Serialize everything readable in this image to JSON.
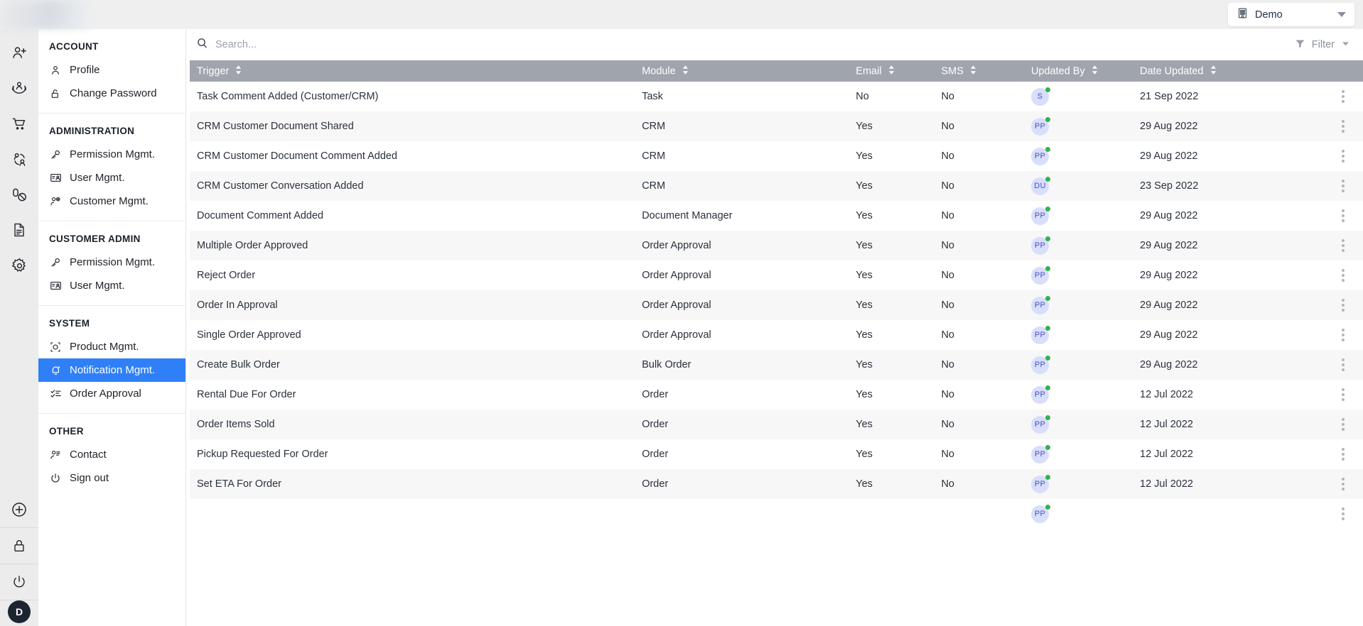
{
  "topbar": {
    "org_label": "Demo",
    "org_icon": "building-icon",
    "caret_icon": "chevron-down-icon"
  },
  "rail": {
    "icons": [
      {
        "name": "add-user-icon"
      },
      {
        "name": "customer-care-icon"
      },
      {
        "name": "shopping-cart-icon"
      },
      {
        "name": "user-group-icon"
      },
      {
        "name": "pills-icon"
      },
      {
        "name": "document-icon"
      },
      {
        "name": "gear-icon"
      }
    ],
    "bottom_icons": [
      {
        "name": "add-circle-icon"
      },
      {
        "name": "lock-icon"
      },
      {
        "name": "power-icon"
      }
    ],
    "avatar_initial": "D"
  },
  "sidebar": {
    "groups": [
      {
        "title": "ACCOUNT",
        "items": [
          {
            "label": "Profile",
            "icon": "user-icon",
            "active": false
          },
          {
            "label": "Change Password",
            "icon": "unlock-icon",
            "active": false
          }
        ]
      },
      {
        "title": "ADMINISTRATION",
        "items": [
          {
            "label": "Permission Mgmt.",
            "icon": "key-icon",
            "active": false
          },
          {
            "label": "User Mgmt.",
            "icon": "id-card-icon",
            "active": false
          },
          {
            "label": "Customer Mgmt.",
            "icon": "user-gear-icon",
            "active": false
          }
        ]
      },
      {
        "title": "CUSTOMER ADMIN",
        "items": [
          {
            "label": "Permission Mgmt.",
            "icon": "key-icon",
            "active": false
          },
          {
            "label": "User Mgmt.",
            "icon": "id-card-icon",
            "active": false
          }
        ]
      },
      {
        "title": "SYSTEM",
        "items": [
          {
            "label": "Product Mgmt.",
            "icon": "box-icon",
            "active": false
          },
          {
            "label": "Notification Mgmt.",
            "icon": "bell-icon",
            "active": true
          },
          {
            "label": "Order Approval",
            "icon": "checklist-icon",
            "active": false
          }
        ]
      },
      {
        "title": "OTHER",
        "items": [
          {
            "label": "Contact",
            "icon": "contact-icon",
            "active": false
          },
          {
            "label": "Sign out",
            "icon": "power-icon",
            "active": false
          }
        ]
      }
    ]
  },
  "toolbar": {
    "search_placeholder": "Search...",
    "search_value": "",
    "search_icon": "search-icon",
    "filter_label": "Filter",
    "filter_icon": "funnel-icon",
    "filter_caret_icon": "chevron-down-icon"
  },
  "table": {
    "columns": [
      {
        "key": "trigger",
        "label": "Trigger",
        "sortable": true
      },
      {
        "key": "module",
        "label": "Module",
        "sortable": true
      },
      {
        "key": "email",
        "label": "Email",
        "sortable": true
      },
      {
        "key": "sms",
        "label": "SMS",
        "sortable": true
      },
      {
        "key": "updated_by",
        "label": "Updated By",
        "sortable": true
      },
      {
        "key": "date_updated",
        "label": "Date Updated",
        "sortable": true
      }
    ],
    "row_action_icon": "kebab-menu-icon",
    "rows": [
      {
        "trigger": "Task Comment Added (Customer/CRM)",
        "module": "Task",
        "email": "No",
        "sms": "No",
        "updated_by": "S",
        "date_updated": "21 Sep 2022",
        "status": "online"
      },
      {
        "trigger": "CRM Customer Document Shared",
        "module": "CRM",
        "email": "Yes",
        "sms": "No",
        "updated_by": "PP",
        "date_updated": "29 Aug 2022",
        "status": "online"
      },
      {
        "trigger": "CRM Customer Document Comment Added",
        "module": "CRM",
        "email": "Yes",
        "sms": "No",
        "updated_by": "PP",
        "date_updated": "29 Aug 2022",
        "status": "online"
      },
      {
        "trigger": "CRM Customer Conversation Added",
        "module": "CRM",
        "email": "Yes",
        "sms": "No",
        "updated_by": "DU",
        "date_updated": "23 Sep 2022",
        "status": "online"
      },
      {
        "trigger": "Document Comment Added",
        "module": "Document Manager",
        "email": "Yes",
        "sms": "No",
        "updated_by": "PP",
        "date_updated": "29 Aug 2022",
        "status": "online"
      },
      {
        "trigger": "Multiple Order Approved",
        "module": "Order Approval",
        "email": "Yes",
        "sms": "No",
        "updated_by": "PP",
        "date_updated": "29 Aug 2022",
        "status": "online"
      },
      {
        "trigger": "Reject Order",
        "module": "Order Approval",
        "email": "Yes",
        "sms": "No",
        "updated_by": "PP",
        "date_updated": "29 Aug 2022",
        "status": "online"
      },
      {
        "trigger": "Order In Approval",
        "module": "Order Approval",
        "email": "Yes",
        "sms": "No",
        "updated_by": "PP",
        "date_updated": "29 Aug 2022",
        "status": "online"
      },
      {
        "trigger": "Single Order Approved",
        "module": "Order Approval",
        "email": "Yes",
        "sms": "No",
        "updated_by": "PP",
        "date_updated": "29 Aug 2022",
        "status": "online"
      },
      {
        "trigger": "Create Bulk Order",
        "module": "Bulk Order",
        "email": "Yes",
        "sms": "No",
        "updated_by": "PP",
        "date_updated": "29 Aug 2022",
        "status": "online"
      },
      {
        "trigger": "Rental Due For Order",
        "module": "Order",
        "email": "Yes",
        "sms": "No",
        "updated_by": "PP",
        "date_updated": "12 Jul 2022",
        "status": "online"
      },
      {
        "trigger": "Order Items Sold",
        "module": "Order",
        "email": "Yes",
        "sms": "No",
        "updated_by": "PP",
        "date_updated": "12 Jul 2022",
        "status": "online"
      },
      {
        "trigger": "Pickup Requested For Order",
        "module": "Order",
        "email": "Yes",
        "sms": "No",
        "updated_by": "PP",
        "date_updated": "12 Jul 2022",
        "status": "online"
      },
      {
        "trigger": "Set ETA For Order",
        "module": "Order",
        "email": "Yes",
        "sms": "No",
        "updated_by": "PP",
        "date_updated": "12 Jul 2022",
        "status": "online"
      },
      {
        "trigger": "",
        "module": "",
        "email": "",
        "sms": "",
        "updated_by": "PP",
        "date_updated": "",
        "status": "online"
      }
    ]
  },
  "colors": {
    "accent": "#2f80f7",
    "header_bg": "#a0a4ac",
    "yes": "#49b26a",
    "no": "#f0707a",
    "avatar_bg": "#d8defb",
    "avatar_fg": "#4552c4",
    "status_dot": "#31b34c"
  }
}
